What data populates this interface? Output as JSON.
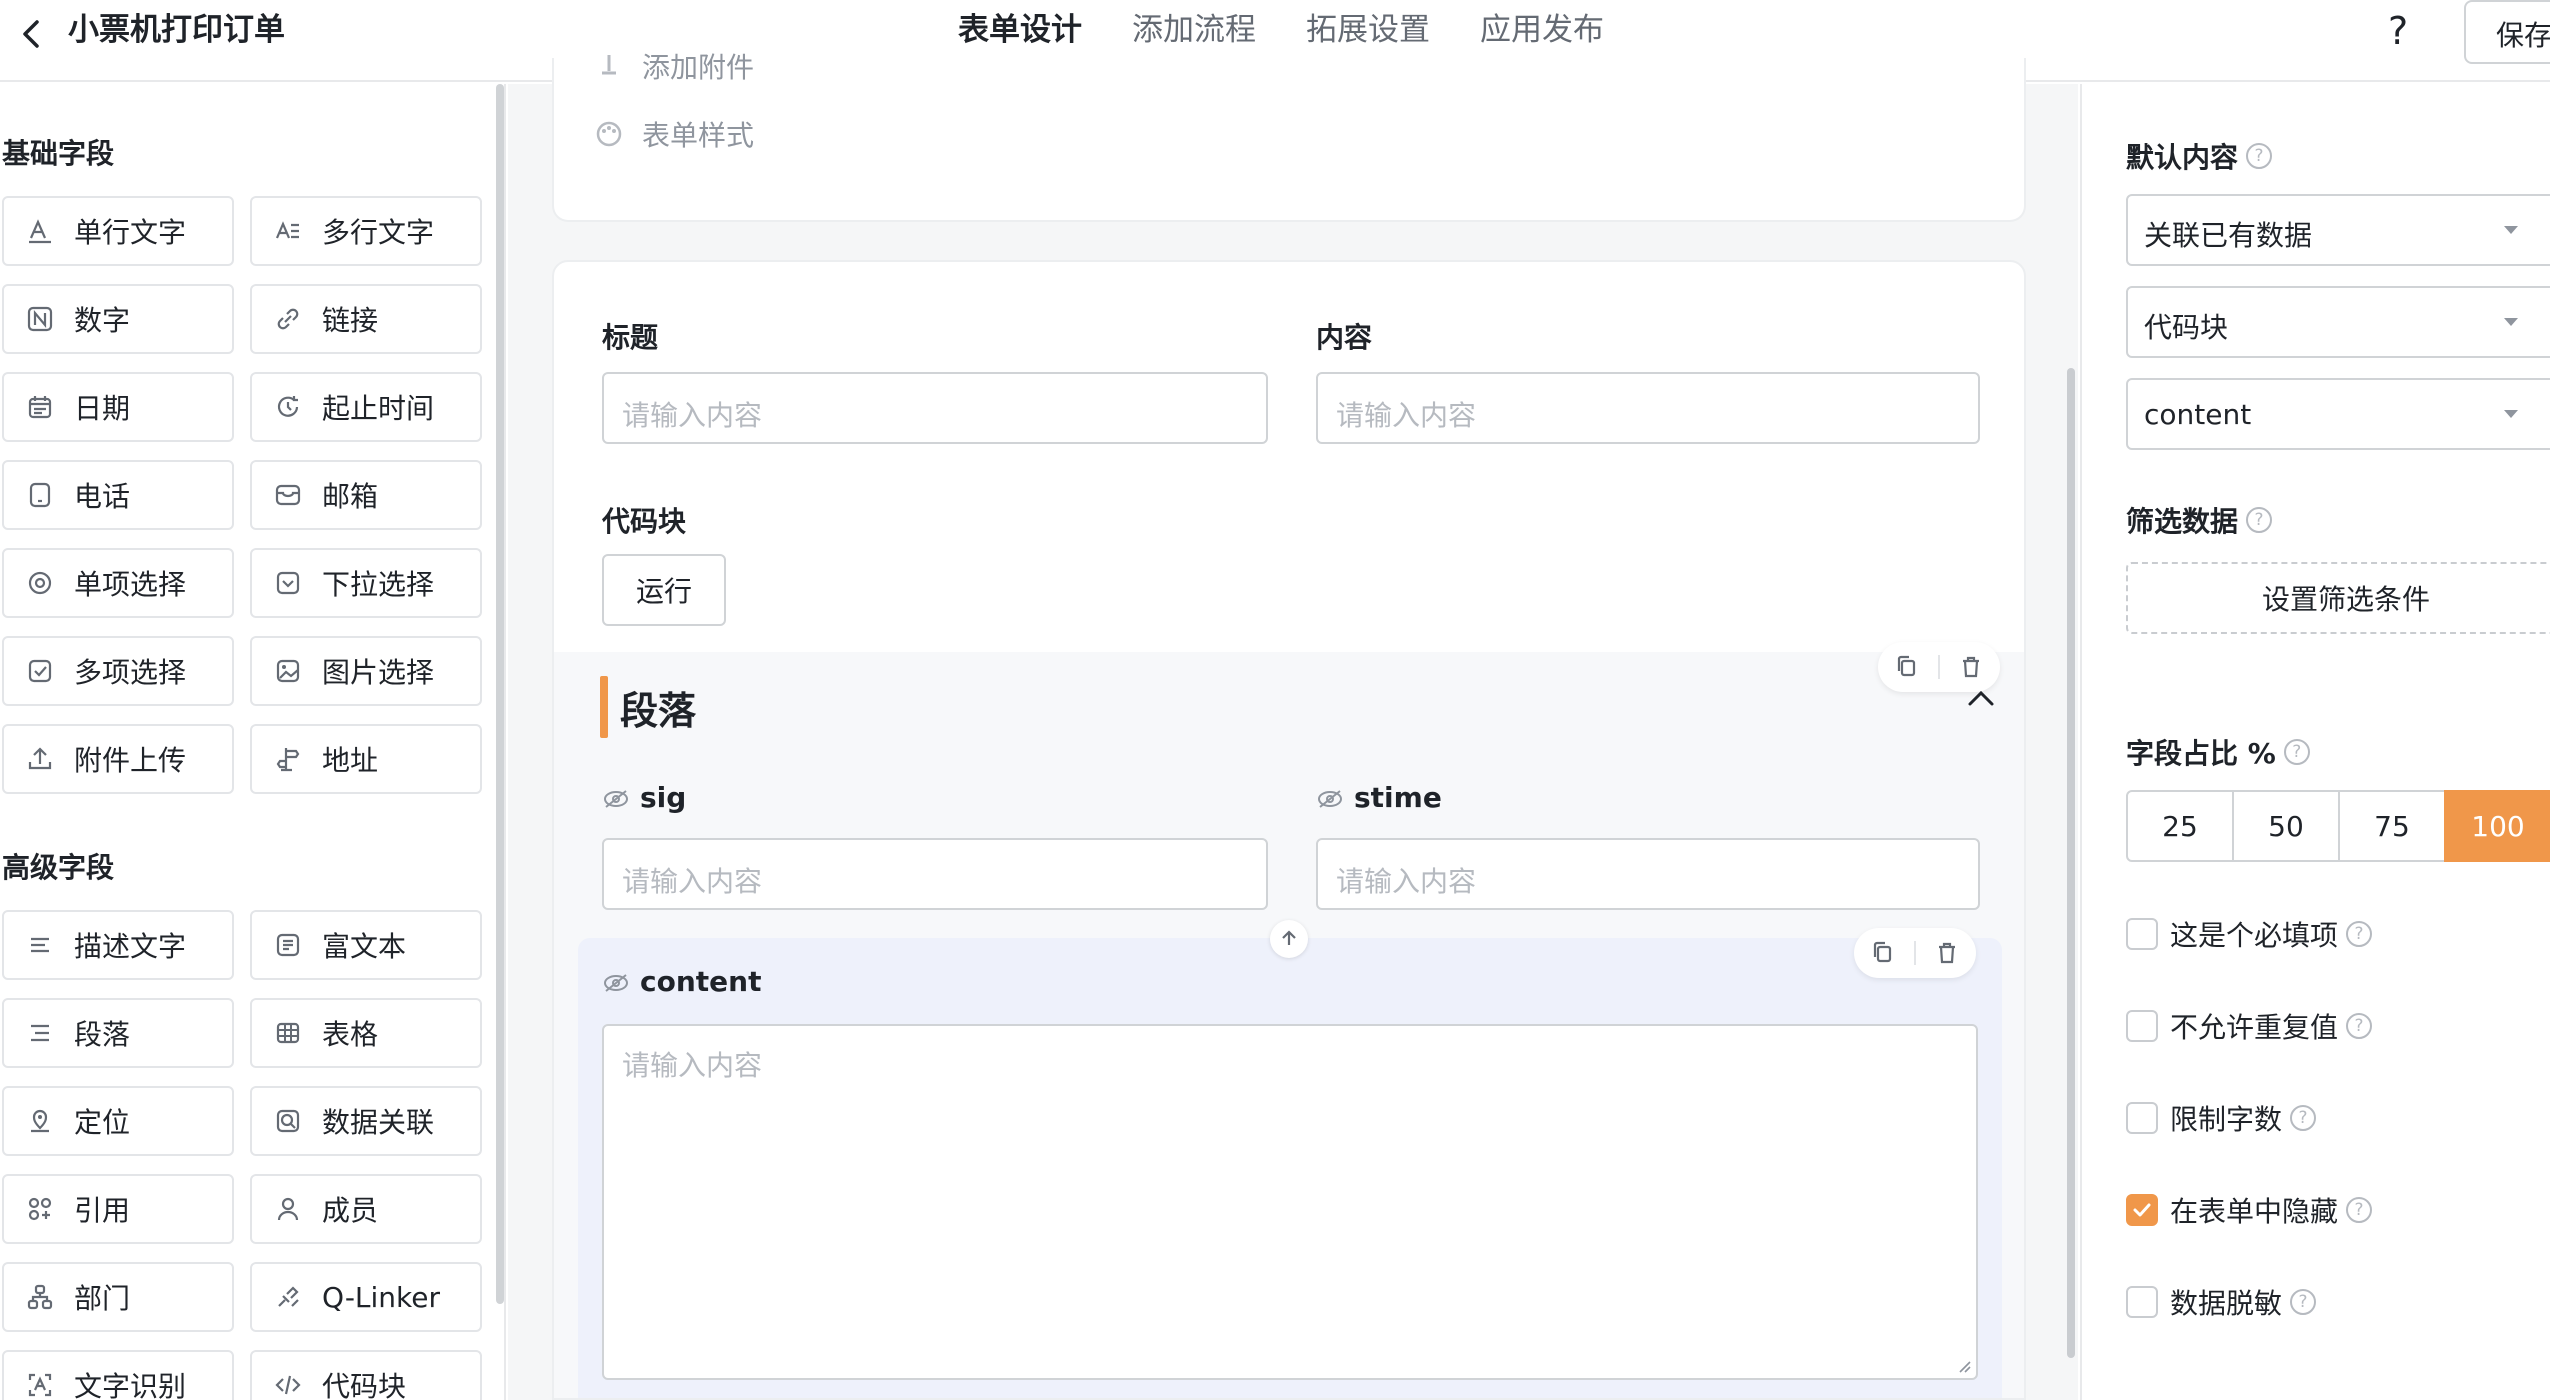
{
  "header": {
    "title": "小票机打印订单",
    "tabs": [
      {
        "label": "表单设计",
        "active": true
      },
      {
        "label": "添加流程",
        "active": false
      },
      {
        "label": "拓展设置",
        "active": false
      },
      {
        "label": "应用发布",
        "active": false
      }
    ],
    "help": "?",
    "save_label": "保存"
  },
  "sidebar": {
    "basic_title": "基础字段",
    "basic_fields": [
      {
        "label": "单行文字",
        "icon": "single-line-text-icon"
      },
      {
        "label": "多行文字",
        "icon": "multi-line-text-icon"
      },
      {
        "label": "数字",
        "icon": "number-icon"
      },
      {
        "label": "链接",
        "icon": "link-icon"
      },
      {
        "label": "日期",
        "icon": "calendar-icon"
      },
      {
        "label": "起止时间",
        "icon": "time-range-icon"
      },
      {
        "label": "电话",
        "icon": "phone-icon"
      },
      {
        "label": "邮箱",
        "icon": "mail-icon"
      },
      {
        "label": "单项选择",
        "icon": "radio-icon"
      },
      {
        "label": "下拉选择",
        "icon": "dropdown-icon"
      },
      {
        "label": "多项选择",
        "icon": "checkbox-icon"
      },
      {
        "label": "图片选择",
        "icon": "image-icon"
      },
      {
        "label": "附件上传",
        "icon": "upload-icon"
      },
      {
        "label": "地址",
        "icon": "address-icon"
      }
    ],
    "advanced_title": "高级字段",
    "advanced_fields": [
      {
        "label": "描述文字",
        "icon": "description-icon"
      },
      {
        "label": "富文本",
        "icon": "rich-text-icon"
      },
      {
        "label": "段落",
        "icon": "paragraph-icon"
      },
      {
        "label": "表格",
        "icon": "table-icon"
      },
      {
        "label": "定位",
        "icon": "location-icon"
      },
      {
        "label": "数据关联",
        "icon": "data-link-icon"
      },
      {
        "label": "引用",
        "icon": "reference-icon"
      },
      {
        "label": "成员",
        "icon": "member-icon"
      },
      {
        "label": "部门",
        "icon": "department-icon"
      },
      {
        "label": "Q-Linker",
        "icon": "qlinker-icon"
      },
      {
        "label": "文字识别",
        "icon": "ocr-icon"
      },
      {
        "label": "代码块",
        "icon": "code-icon"
      }
    ]
  },
  "canvas": {
    "top_items": [
      {
        "label": "添加附件",
        "icon": "attachment-icon"
      },
      {
        "label": "表单样式",
        "icon": "palette-icon"
      }
    ],
    "title_label": "标题",
    "title_placeholder": "请输入内容",
    "content_label": "内容",
    "content_placeholder": "请输入内容",
    "code_label": "代码块",
    "run_label": "运行",
    "section_title": "段落",
    "sig_label": "sig",
    "sig_placeholder": "请输入内容",
    "stime_label": "stime",
    "stime_placeholder": "请输入内容",
    "content_block_label": "content",
    "content_block_placeholder": "请输入内容"
  },
  "right_panel": {
    "default_label": "默认内容",
    "selects": [
      "关联已有数据",
      "代码块",
      "content"
    ],
    "filter_label": "筛选数据",
    "filter_button": "设置筛选条件",
    "ratio_label": "字段占比 %",
    "ratio_options": [
      "25",
      "50",
      "75",
      "100"
    ],
    "ratio_selected": "100",
    "checks": [
      {
        "label": "这是个必填项",
        "checked": false
      },
      {
        "label": "不允许重复值",
        "checked": false
      },
      {
        "label": "限制字数",
        "checked": false
      },
      {
        "label": "在表单中隐藏",
        "checked": true
      },
      {
        "label": "数据脱敏",
        "checked": false
      }
    ]
  },
  "colors": {
    "accent": "#f0974a",
    "text": "#1f2329",
    "muted": "#8f959e",
    "border": "#d0d3d6"
  }
}
